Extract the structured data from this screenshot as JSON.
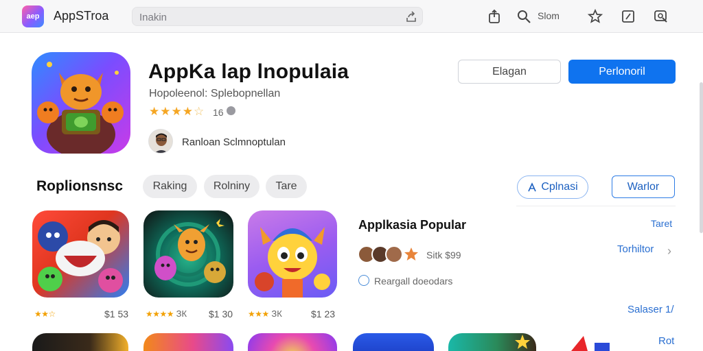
{
  "topbar": {
    "logo_text": "aep",
    "app_name": "AppSTroa",
    "search_placeholder": "Inakin",
    "account_text": "Slom"
  },
  "hero": {
    "title": "AppKa lap lnopulaia",
    "subtitle": "Hopoleenol: Splebopnellan",
    "stars": "★★★★",
    "half_star": "☆",
    "rating_count": "16",
    "developer": "Ranloan Sclmnoptulan",
    "secondary_button": "Elagan",
    "primary_button": "Perlonoril"
  },
  "section": {
    "title": "Roplionsnsc",
    "chips": [
      "Raking",
      "Rolniny",
      "Tare"
    ],
    "outline_button": "Cplnasi",
    "outline_button_icon": "person-icon",
    "square_button": "Warlor"
  },
  "cards": [
    {
      "stars": "★★☆",
      "meta": "",
      "price": "$1 53"
    },
    {
      "stars": "★★★★",
      "meta": "ЗК",
      "price": "$1 30"
    },
    {
      "stars": "★★★",
      "meta": "ЗК",
      "price": "$1 23"
    }
  ],
  "featured": {
    "title": "Applkasia Popular",
    "count": "Sitk $99",
    "downloads": "Reargall doeodars"
  },
  "links": {
    "top": "Taret",
    "middle": "Torhiltor",
    "lower": "Salaser 1/",
    "bottom": "Rot"
  },
  "colors": {
    "accent": "#0f73ef",
    "star": "#f5a623",
    "link": "#2a6fd1"
  }
}
